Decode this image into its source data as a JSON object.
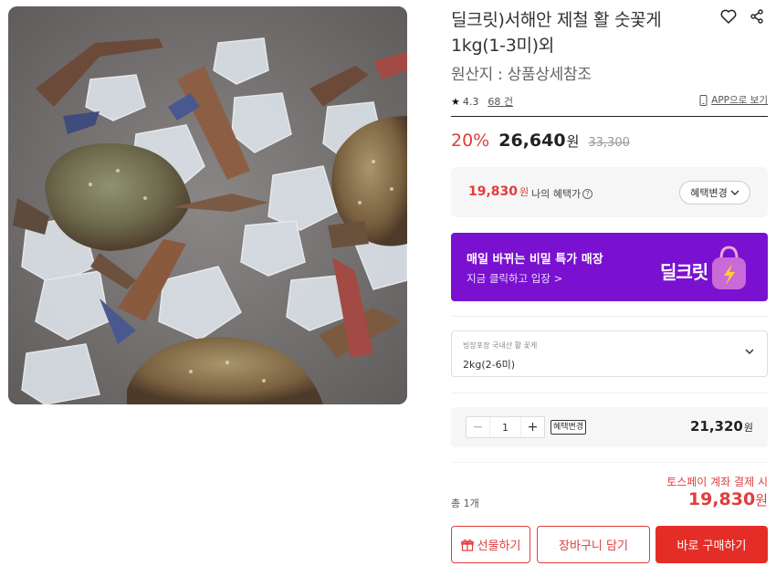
{
  "product": {
    "title": "딜크릿)서해안 제철 활 숫꽃게 1kg(1-3미)외",
    "origin": "원산지 : 상품상세참조",
    "rating": "4.3",
    "review_count": "68 건",
    "app_link": "APP으로 보기"
  },
  "price": {
    "discount": "20%",
    "sale_price": "26,640",
    "currency": "원",
    "original_price": "33,300"
  },
  "benefit": {
    "price": "19,830",
    "currency": "원",
    "label": "나의 혜택가",
    "change_button": "혜택변경"
  },
  "promo": {
    "title": "매일 바뀌는 비밀 특가 매장",
    "subtitle": "지금 클릭하고 입장 >",
    "logo": "딜크릿"
  },
  "option": {
    "label": "빙장포장 국내산 활 꽃게",
    "value": "2kg(2-6미)"
  },
  "quantity": {
    "minus": "−",
    "value": "1",
    "plus": "+",
    "tag": "혜택변경",
    "price": "21,320",
    "currency": "원"
  },
  "summary": {
    "toss_note": "토스페이 계좌 결제 시",
    "total_label": "총 1개",
    "total_price": "19,830",
    "currency": "원"
  },
  "buttons": {
    "gift": "선물하기",
    "cart": "장바구니 담기",
    "buy": "바로 구매하기"
  },
  "colors": {
    "accent_red": "#e23c3c",
    "promo_purple": "#7a10d0"
  },
  "icons": [
    "heart-icon",
    "share-icon",
    "star-icon",
    "phone-icon",
    "info-icon",
    "chevron-down-icon",
    "gift-icon"
  ]
}
